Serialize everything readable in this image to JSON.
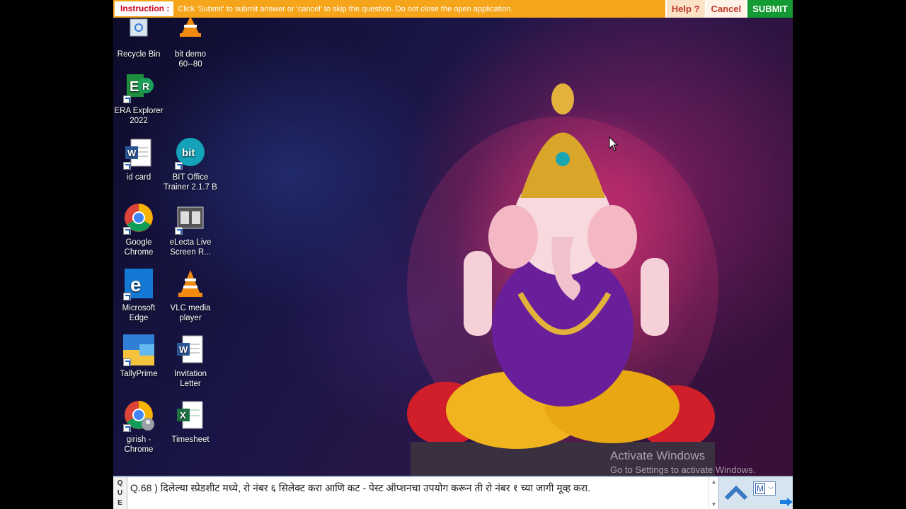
{
  "instruction_bar": {
    "label": "Instruction :",
    "text": "Click 'Submit' to submit answer or 'cancel' to skip the question. Do not close the open application.",
    "help_label": "Help ?",
    "cancel_label": "Cancel",
    "submit_label": "SUBMIT",
    "colors": {
      "bar": "#f6a51a",
      "submit": "#139a32",
      "label_text": "#d0021b"
    }
  },
  "desktop": {
    "icons": [
      {
        "label": "Recycle Bin",
        "icon": "recycle-bin-icon"
      },
      {
        "label": "bit demo\n60--80",
        "icon": "vlc-cone-icon"
      },
      {
        "label": "ERA Explorer\n2022",
        "icon": "era-explorer-icon"
      },
      {
        "label": "id card",
        "icon": "word-document-icon"
      },
      {
        "label": "BIT Office\nTrainer 2.1.7 B",
        "icon": "bit-office-icon"
      },
      {
        "label": "Google\nChrome",
        "icon": "chrome-icon"
      },
      {
        "label": "eLecta Live\nScreen R...",
        "icon": "film-strip-icon"
      },
      {
        "label": "Microsoft\nEdge",
        "icon": "edge-icon"
      },
      {
        "label": "VLC media\nplayer",
        "icon": "vlc-cone-icon"
      },
      {
        "label": "TallyPrime",
        "icon": "tallyprime-icon"
      },
      {
        "label": "Invitation\nLetter",
        "icon": "word-document-icon"
      },
      {
        "label": "girish -\nChrome",
        "icon": "chrome-profile-icon"
      },
      {
        "label": "Timesheet",
        "icon": "excel-icon"
      }
    ],
    "watermark": {
      "title": "Activate Windows",
      "subtitle": "Go to Settings to activate Windows."
    }
  },
  "question_bar": {
    "side_letters": [
      "Q",
      "U",
      "E"
    ],
    "text": "Q.68 ) दिलेल्या स्प्रेडशीट मध्ये, रो नंबर ६ सिलेक्ट करा आणि कट - पेस्ट ऑप्शनचा उपयोग करून ती रो नंबर १ च्या जागी मूव्ह करा.",
    "language_value": "M",
    "colors": {
      "tools_bg": "#d6e4f0"
    }
  }
}
